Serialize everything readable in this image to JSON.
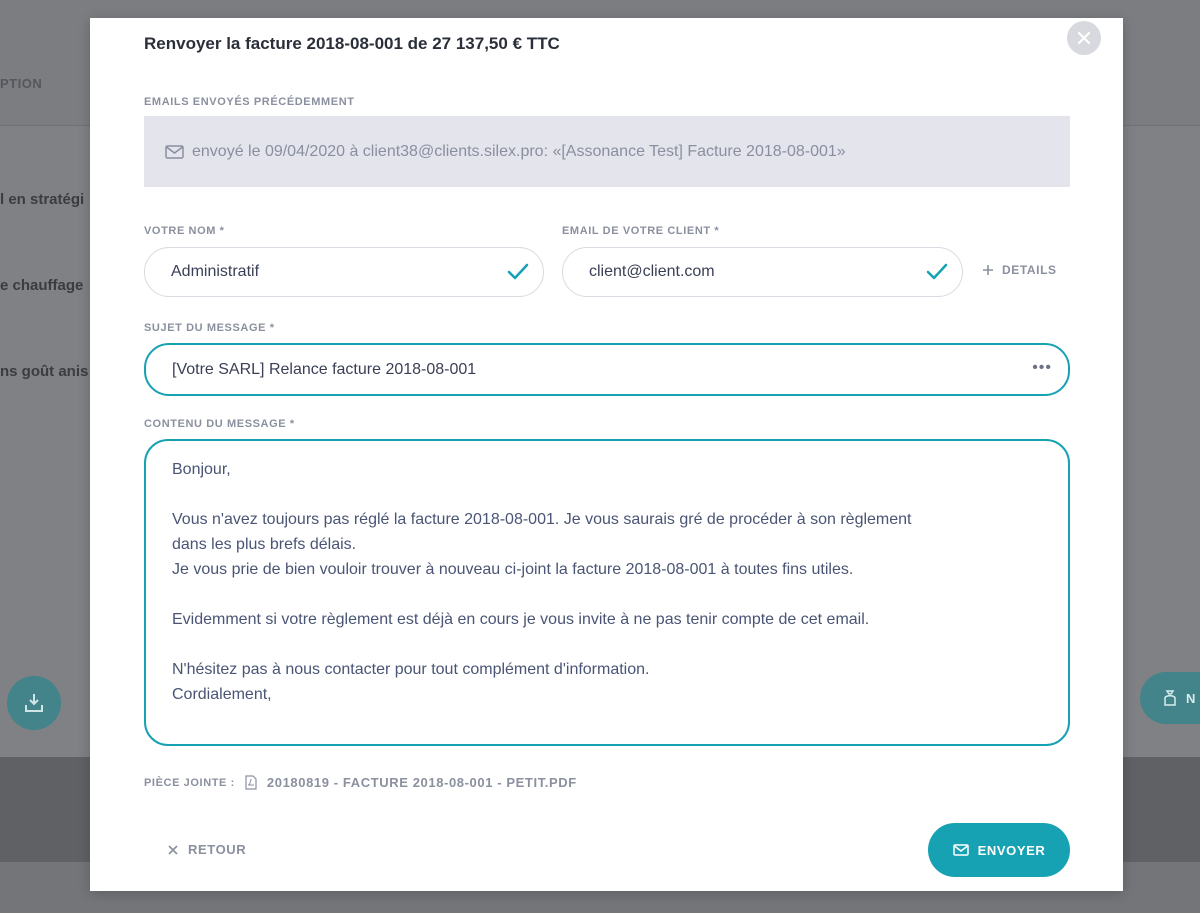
{
  "background": {
    "column_label": "PTION",
    "rows": [
      "l en stratégi",
      "e chauffage",
      "ns goût anis"
    ],
    "right_button_label": "N"
  },
  "modal": {
    "title": "Renvoyer la facture 2018-08-001 de 27 137,50 € TTC",
    "close_icon": "close-icon",
    "sent_section": {
      "label": "EMAILS ENVOYÉS PRÉCÉDEMMENT",
      "entry_icon": "envelope-icon",
      "entry_text": "envoyé le 09/04/2020 à client38@clients.silex.pro:  «[Assonance Test] Facture 2018-08-001»"
    },
    "name_field": {
      "label": "VOTRE NOM *",
      "value": "Administratif",
      "icon": "check-icon"
    },
    "client_email_field": {
      "label": "EMAIL DE VOTRE CLIENT *",
      "value": "client@client.com",
      "icon": "check-icon"
    },
    "details_link": {
      "label": "DETAILS",
      "icon": "plus-icon"
    },
    "subject_field": {
      "label": "SUJET DU MESSAGE *",
      "value": "[Votre SARL] Relance facture 2018-08-001",
      "more": "•••"
    },
    "content_field": {
      "label": "CONTENU DU MESSAGE *",
      "lines": [
        "Bonjour,",
        "",
        "Vous n'avez toujours pas réglé la facture 2018-08-001. Je vous saurais gré de procéder à son règlement",
        "dans les plus brefs délais.",
        "Je vous prie de bien vouloir trouver à nouveau ci-joint la facture 2018-08-001 à toutes fins utiles.",
        "",
        "Evidemment si votre règlement est déjà en cours je vous invite à ne pas tenir compte de cet email.",
        "",
        "N'hésitez pas à nous contacter pour tout complément d'information.",
        "Cordialement,"
      ]
    },
    "attachment": {
      "label": "PIÈCE JOINTE :",
      "icon": "pdf-file-icon",
      "filename": "20180819 - FACTURE 2018-08-001 - PETIT.PDF"
    },
    "back_button": {
      "label": "RETOUR",
      "icon": "close-x-icon"
    },
    "send_button": {
      "label": "ENVOYER",
      "icon": "envelope-icon"
    }
  },
  "colors": {
    "accent": "#17a2b3",
    "muted_text": "#8a909e",
    "sent_box_bg": "#e3e4ec"
  }
}
